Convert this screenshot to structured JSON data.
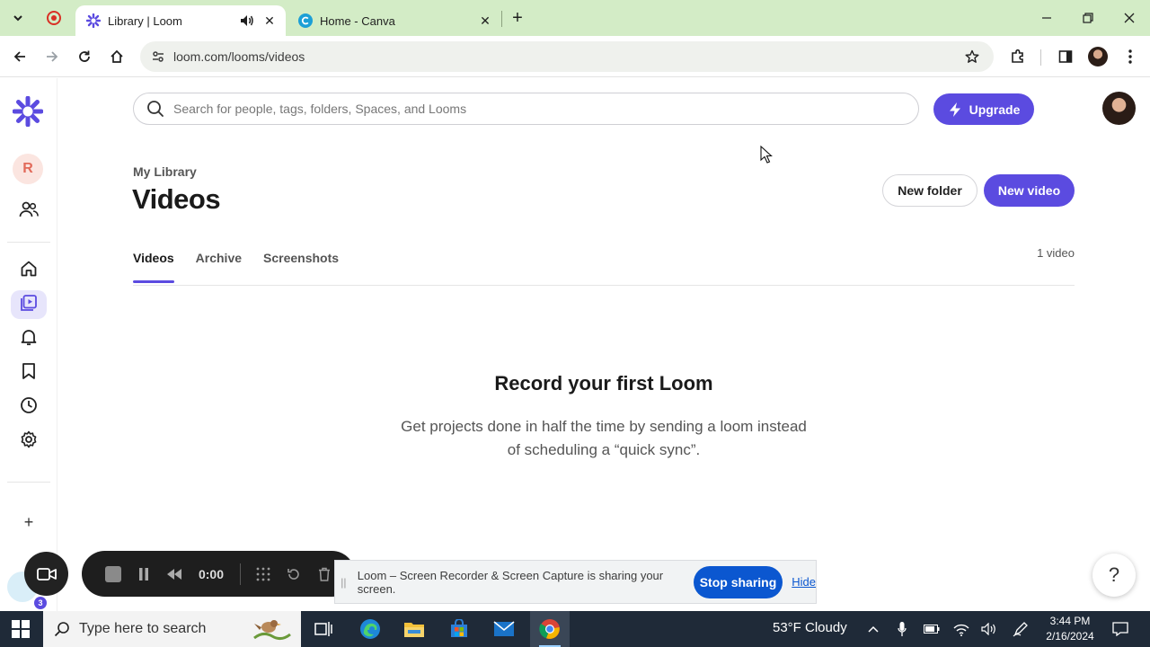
{
  "browser": {
    "tabs": [
      {
        "title": "Library | Loom",
        "active": true
      },
      {
        "title": "Home - Canva",
        "active": false
      }
    ],
    "url": "loom.com/looms/videos"
  },
  "loom": {
    "search_placeholder": "Search for people, tags, folders, Spaces, and Looms",
    "upgrade_label": "Upgrade",
    "workspace_initial": "R",
    "breadcrumb": "My Library",
    "page_title": "Videos",
    "new_folder_label": "New folder",
    "new_video_label": "New video",
    "tabs": [
      "Videos",
      "Archive",
      "Screenshots"
    ],
    "video_count": "1 video",
    "empty_title": "Record your first Loom",
    "empty_desc": "Get projects done in half the time by sending a loom instead of scheduling a “quick sync”.",
    "help_label": "?"
  },
  "recorder": {
    "time": "0:00",
    "badge_count": "3",
    "share_message": "Loom – Screen Recorder & Screen Capture is sharing your screen.",
    "stop_sharing_label": "Stop sharing",
    "hide_label": "Hide"
  },
  "taskbar": {
    "search_placeholder": "Type here to search",
    "weather": "53°F  Cloudy",
    "time": "3:44 PM",
    "date": "2/16/2024"
  },
  "colors": {
    "loom_purple": "#5b4be0",
    "chrome_tab_strip": "#d3ecc6",
    "stop_sharing_blue": "#0b57d0",
    "taskbar": "#1f2a38"
  }
}
